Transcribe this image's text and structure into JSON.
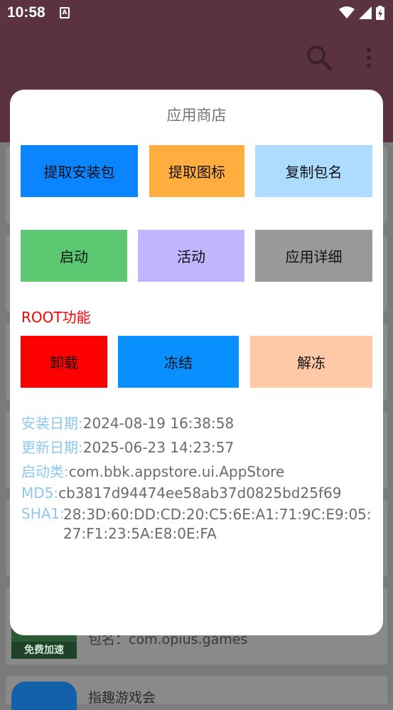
{
  "status": {
    "time": "10:58",
    "notification_icon": "A"
  },
  "dialog": {
    "title": "应用商店",
    "row1": [
      "提取安装包",
      "提取图标",
      "复制包名"
    ],
    "row2": [
      "启动",
      "活动",
      "应用详细"
    ],
    "root_label": "ROOT功能",
    "row3": [
      "卸载",
      "冻结",
      "解冻"
    ],
    "info": {
      "install_key": "安装日期:",
      "install_val": "2024-08-19 16:38:58",
      "update_key": "更新日期:",
      "update_val": "2025-06-23 14:23:57",
      "launch_key": "启动类:",
      "launch_val": "com.bbk.appstore.ui.AppStore",
      "md5_key": "MD5:",
      "md5_val": "cb3817d94474ee58ab37d0825bd25f69",
      "sha1_key": "SHA1:",
      "sha1_val": "28:3D:60:DD:CD:20:C5:6E:A1:71:9C:E9:05:27:F1:23:5A:E8:0E:FA"
    }
  },
  "background": {
    "thumb_label": "免费加速",
    "pkg_text": "包名：com.opius.games",
    "next_app_name": "指趣游戏会"
  },
  "colors": {
    "appbar": "#5b333f",
    "blue": "#0a84ff",
    "orange": "#ffad3f",
    "light_blue": "#aedcff",
    "green": "#5cc872",
    "lavender": "#c3b5fd",
    "gray": "#999999",
    "red": "#ff0000",
    "blue2": "#0a8fff",
    "peach": "#ffc9a8",
    "info_key": "#8ec7f0"
  },
  "icons": [
    "search-icon",
    "more-vert-icon",
    "wifi-icon",
    "signal-icon",
    "battery-icon"
  ]
}
